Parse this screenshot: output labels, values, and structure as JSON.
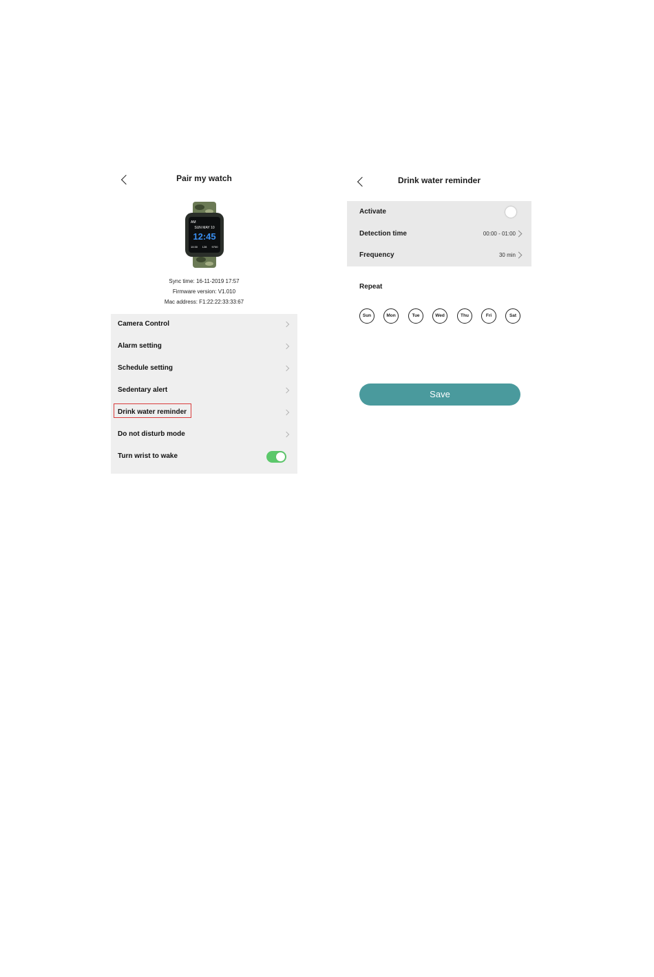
{
  "left_screen": {
    "title": "Pair my watch",
    "watch_display": {
      "top_left": "AM",
      "date": "SUN MAY 10",
      "time": "12:45",
      "bottom_values": [
        "10:30",
        "128",
        "9700"
      ]
    },
    "info": {
      "sync": "Sync time: 16-11-2019 17:57",
      "firmware": "Firmware version: V1.010",
      "mac": "Mac address: F1:22:22:33:33:67"
    },
    "menu": [
      {
        "label": "Camera Control"
      },
      {
        "label": "Alarm setting"
      },
      {
        "label": "Schedule setting"
      },
      {
        "label": "Sedentary alert"
      },
      {
        "label": "Drink water reminder"
      },
      {
        "label": "Do not disturb mode"
      },
      {
        "label": "Turn wrist to wake",
        "toggle": true
      }
    ]
  },
  "right_screen": {
    "title": "Drink water reminder",
    "settings": {
      "activate": {
        "label": "Activate",
        "enabled": false
      },
      "detection": {
        "label": "Detection time",
        "value": "00:00 - 01:00"
      },
      "frequency": {
        "label": "Frequency",
        "value": "30 min"
      }
    },
    "repeat_label": "Repeat",
    "days": [
      "Sun",
      "Mon",
      "Tue",
      "Wed",
      "Thu",
      "Fri",
      "Sat"
    ],
    "save_label": "Save"
  },
  "colors": {
    "highlight_border": "#d93b3b",
    "toggle_on": "#5cc86b",
    "save_button": "#4a9a9d",
    "menu_background": "#efefef",
    "settings_background": "#e9e9e9"
  }
}
